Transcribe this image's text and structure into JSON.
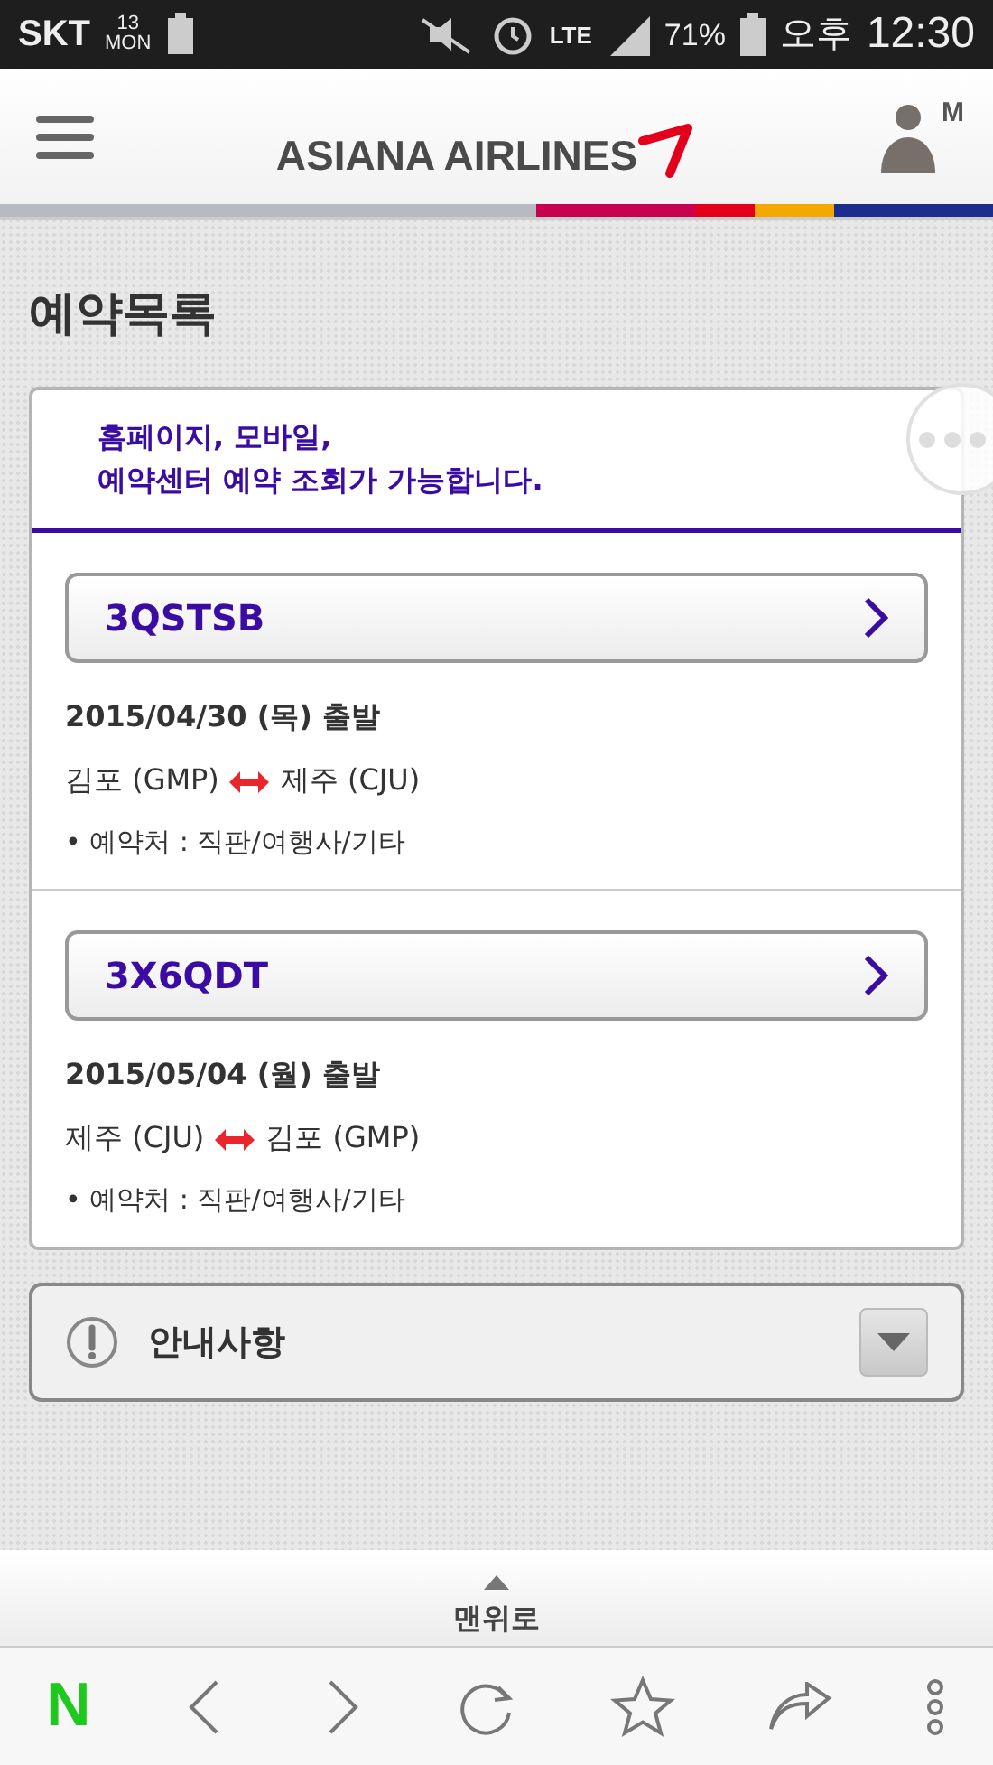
{
  "status_bar": {
    "carrier": "SKT",
    "date_day": "13",
    "date_weekday": "MON",
    "network": "LTE",
    "battery": "71%",
    "ampm": "오후",
    "time": "12:30"
  },
  "header": {
    "logo": "ASIANA AIRLINES",
    "user_badge": "M"
  },
  "page_title": "예약목록",
  "notice_lines": [
    "홈페이지, 모바일,",
    "예약센터 예약 조회가 가능합니다."
  ],
  "reservations": [
    {
      "code": "3QSTSB",
      "date": "2015/04/30 (목) 출발",
      "from": "김포 (GMP)",
      "to": "제주 (CJU)",
      "source": "• 예약처 : 직판/여행사/기타"
    },
    {
      "code": "3X6QDT",
      "date": "2015/05/04 (월) 출발",
      "from": "제주 (CJU)",
      "to": "김포 (GMP)",
      "source": "• 예약처 : 직판/여행사/기타"
    }
  ],
  "info_panel": {
    "title": "안내사항",
    "expanded": false
  },
  "top_button": "맨위로",
  "browser_bar": {
    "logo": "N"
  }
}
